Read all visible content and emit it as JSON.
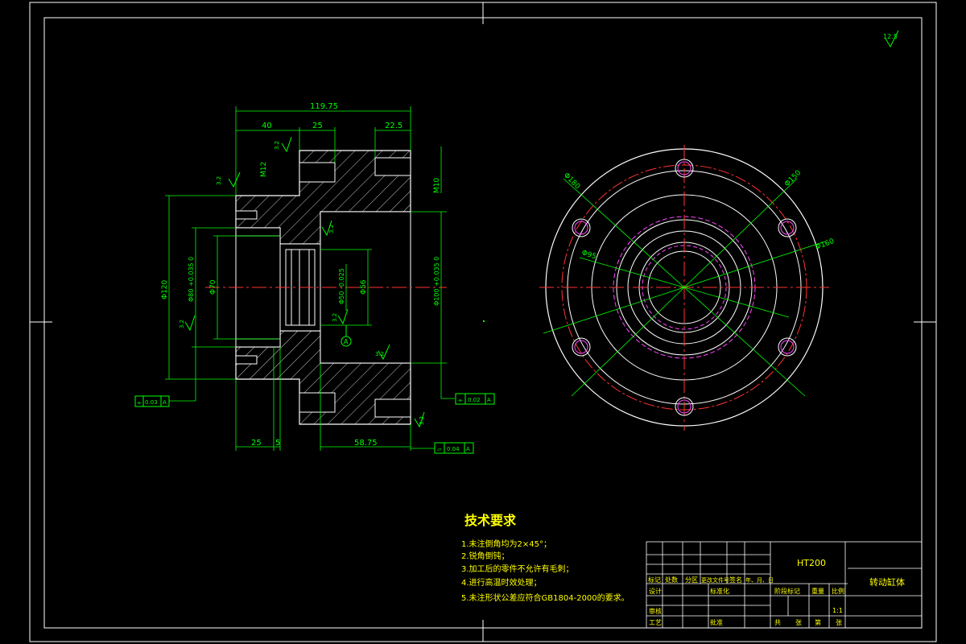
{
  "drawing": {
    "roughness_main": "12.5",
    "section_view": {
      "dims": {
        "overall_width": "119.75",
        "d40": "40",
        "d25_top": "25",
        "d22_5": "22.5",
        "m12": "M12",
        "m10": "M10",
        "phi120": "Φ120",
        "phi80": "Φ80 +0.035 0",
        "phi70": "Φ70",
        "phi50": "Φ50 -0.025",
        "phi56": "Φ56",
        "phi100": "Φ100 +0.035 0",
        "d25_bottom": "25",
        "d5": "5",
        "d58_75": "58.75",
        "roughness_32": "3.2",
        "datum_a": "A"
      },
      "tolerance_frames": [
        {
          "symbol": "⌯",
          "value": "0.03",
          "datum": "A"
        },
        {
          "symbol": "⌯",
          "value": "0.02",
          "datum": "A"
        },
        {
          "symbol": "▱",
          "value": "0.04",
          "datum": "A"
        }
      ]
    },
    "end_view": {
      "labels": {
        "phi180": "Φ180",
        "phi150": "Φ150",
        "phi160": "Φ160",
        "phi95": "Φ95"
      }
    },
    "tech_requirements": {
      "title": "技术要求",
      "items": [
        "1.未注倒角均为2×45°；",
        "2.锐角倒钝；",
        "3.加工后的零件不允许有毛刺；",
        "4.进行高温时效处理；",
        "5.未注形状公差应符合GB1804-2000的要求。"
      ]
    },
    "title_block": {
      "material": "HT200",
      "part_name": "转动缸体",
      "scale": "1:1",
      "row_labels": [
        "标记",
        "处数",
        "分区",
        "更改文件号",
        "签名",
        "年、月、日"
      ],
      "left_labels": [
        "设计",
        "标准化",
        "审核",
        "工艺",
        "批准"
      ],
      "right_labels": [
        "阶段标记",
        "重量",
        "比例"
      ],
      "sheet_labels": [
        "共",
        "张",
        "第",
        "张"
      ]
    }
  },
  "colors": {
    "background": "#000000",
    "outline": "#ffffff",
    "dimension": "#00ff00",
    "centerline": "#ff3333",
    "hatch": "#ffffff",
    "hidden": "#ff44ff",
    "text_yellow": "#ffff00"
  }
}
